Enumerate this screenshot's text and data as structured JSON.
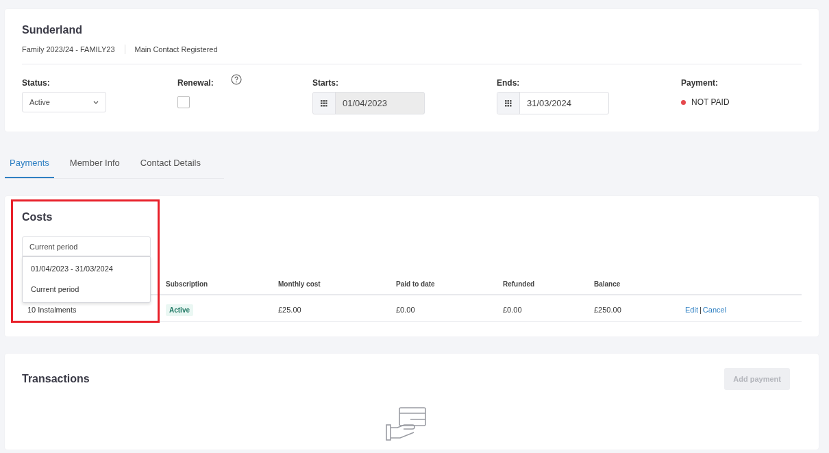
{
  "header": {
    "title": "Sunderland",
    "meta": [
      "Family 2023/24 - FAMILY23",
      "Main Contact Registered"
    ]
  },
  "fields": [
    {
      "kind": "select",
      "label": "Status:",
      "value": "Active"
    },
    {
      "kind": "checkbox",
      "label": "Renewal:",
      "checked": false
    },
    {
      "kind": "date",
      "label": "Starts:",
      "value": "01/04/2023",
      "disabled": true
    },
    {
      "kind": "date",
      "label": "Ends:",
      "value": "31/03/2024",
      "disabled": false
    },
    {
      "kind": "status",
      "label": "Payment:",
      "value": "NOT PAID",
      "color": "#e5484d"
    }
  ],
  "tabs": [
    {
      "label": "Payments",
      "selected": true
    },
    {
      "label": "Member Info",
      "selected": false
    },
    {
      "label": "Contact Details",
      "selected": false
    }
  ],
  "costs": {
    "title": "Costs",
    "period_select": {
      "value": "Current period",
      "expanded": true,
      "options": [
        "01/04/2023 - 31/03/2024",
        "Current period"
      ]
    },
    "table": {
      "columns": [
        "",
        "Subscription",
        "Monthly cost",
        "Paid to date",
        "Refunded",
        "Balance",
        ""
      ],
      "rows": [
        {
          "cells": [
            "10 Instalments",
            "Active",
            "£25.00",
            "£0.00",
            "£0.00",
            "£250.00"
          ],
          "actions": [
            "Edit",
            "Cancel"
          ],
          "action_separator": "|"
        }
      ]
    }
  },
  "transactions": {
    "title": "Transactions",
    "button": {
      "label": "Add payment",
      "disabled": true
    }
  }
}
